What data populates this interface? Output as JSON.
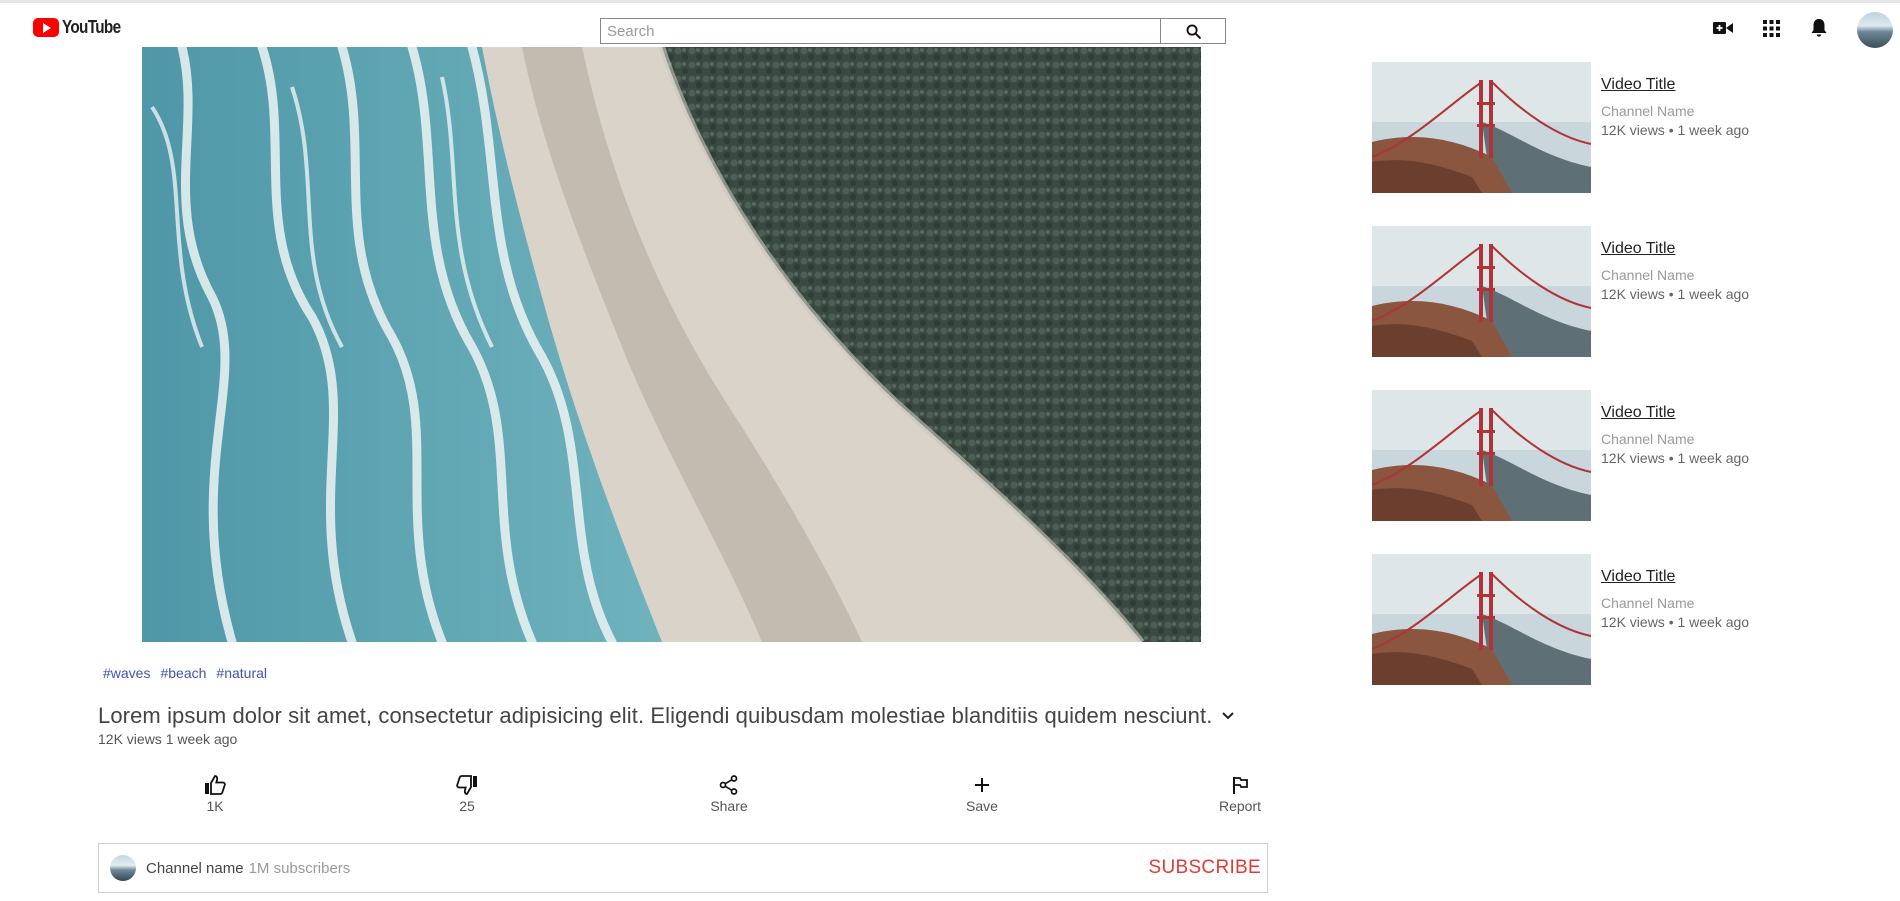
{
  "header": {
    "logo_text": "YouTube",
    "search_placeholder": "Search",
    "icons": [
      "search-icon",
      "create-video-icon",
      "apps-icon",
      "bell-icon",
      "avatar"
    ]
  },
  "video": {
    "tags": [
      "#waves",
      "#beach",
      "#natural"
    ],
    "title": "Lorem ipsum dolor sit amet, consectetur adipisicing elit. Eligendi quibusdam molestiae blanditiis quidem nesciunt.",
    "meta": "12K views 1 week ago"
  },
  "actions": {
    "like": "1K",
    "dislike": "25",
    "share": "Share",
    "save": "Save",
    "report": "Report"
  },
  "channel": {
    "name": "Channel name",
    "subscribers": "1M subscribers",
    "subscribe_label": "SUBSCRIBE"
  },
  "sidebar": {
    "items": [
      {
        "title": "Video Title",
        "channel": "Channel Name",
        "meta": "12K views • 1 week ago"
      },
      {
        "title": "Video Title",
        "channel": "Channel Name",
        "meta": "12K views • 1 week ago"
      },
      {
        "title": "Video Title",
        "channel": "Channel Name",
        "meta": "12K views • 1 week ago"
      },
      {
        "title": "Video Title",
        "channel": "Channel Name",
        "meta": "12K views • 1 week ago"
      }
    ]
  },
  "colors": {
    "brand_red": "#ff0000",
    "subscribe_red": "#e53935",
    "tag_blue": "#3f51b5"
  }
}
